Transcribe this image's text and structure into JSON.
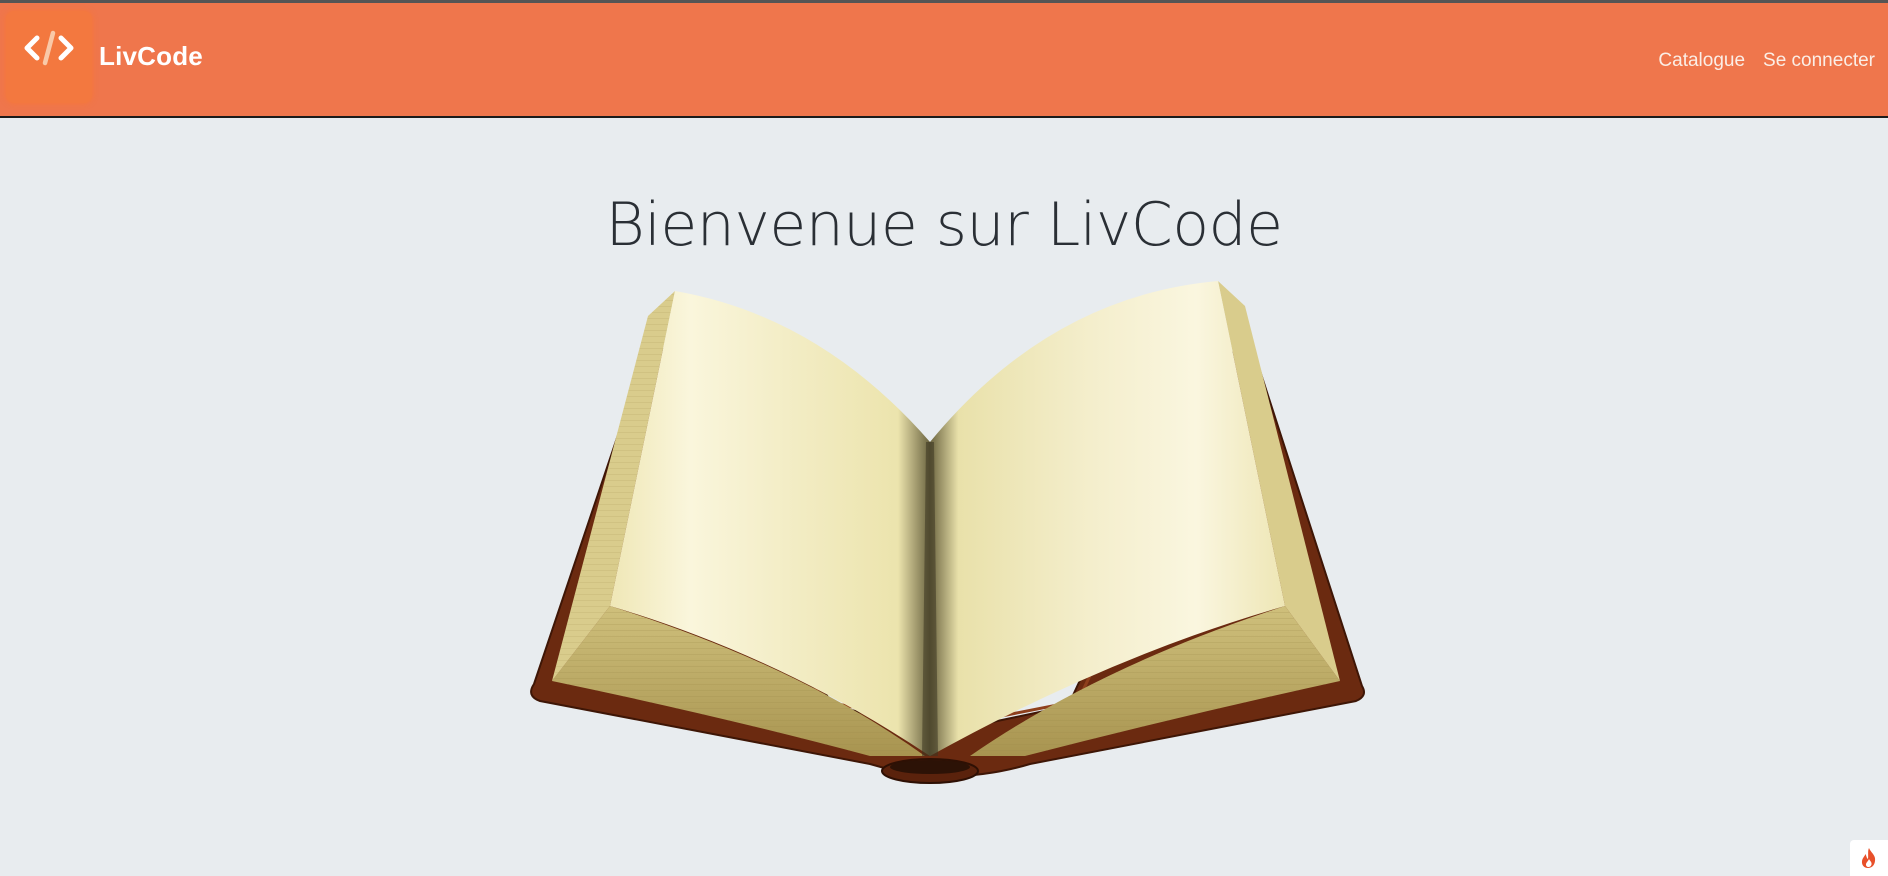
{
  "navbar": {
    "brand": "LivCode",
    "logo_icon": "code-icon",
    "links": [
      "Catalogue",
      "Se connecter"
    ]
  },
  "hero": {
    "title": "Bienvenue sur LivCode",
    "image": "open-book-illustration"
  },
  "corner_badge": {
    "icon": "flame-icon"
  },
  "colors": {
    "navbar_bg": "#ef764c",
    "page_bg": "#e8ecef",
    "book_cover": "#6b2a10",
    "page_paper": "#f2edc8"
  }
}
